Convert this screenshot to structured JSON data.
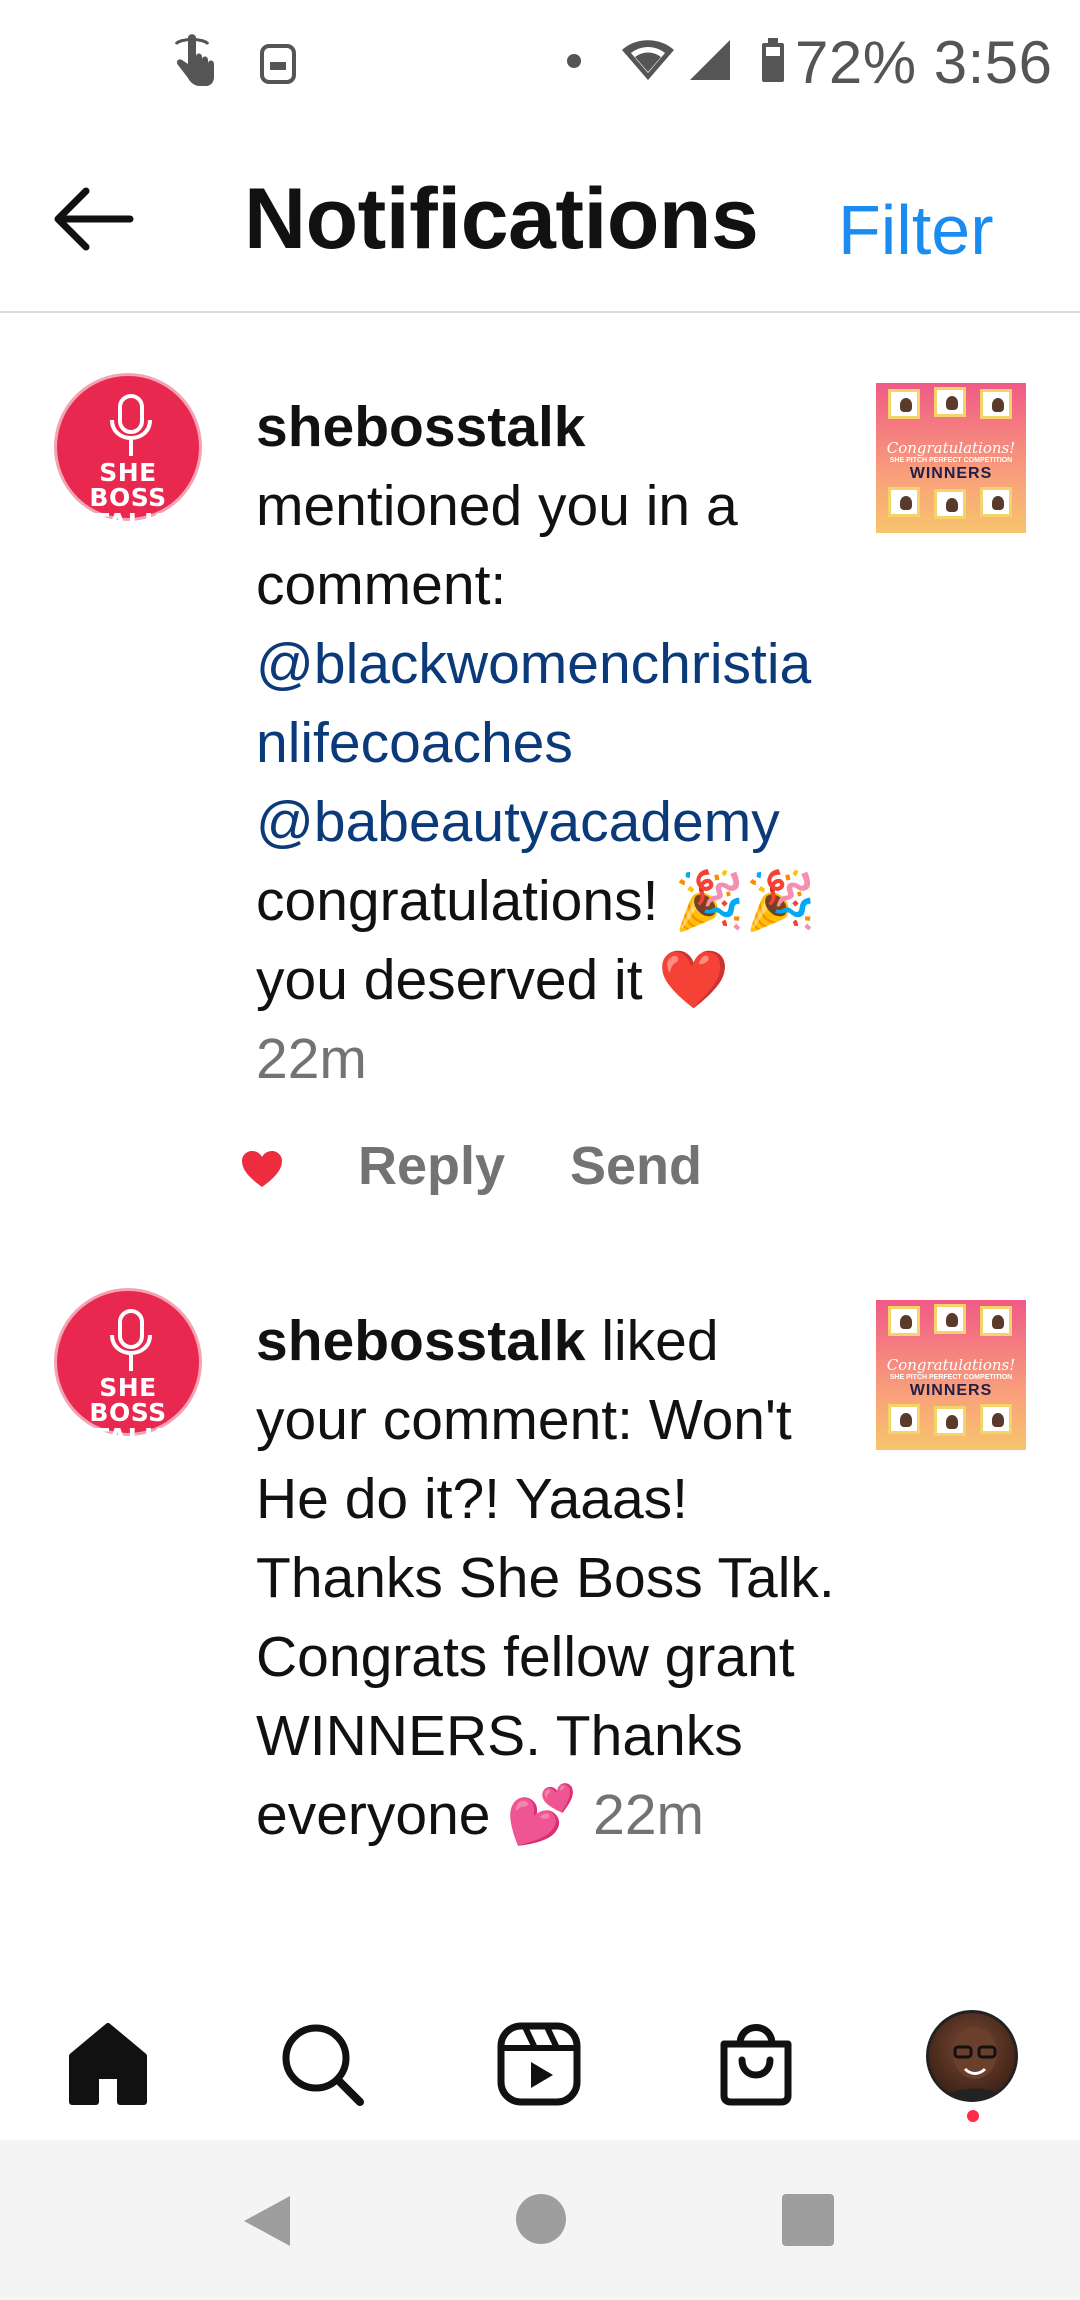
{
  "status_bar": {
    "battery": "72%",
    "time": "3:56",
    "icons": [
      "touch-gesture-icon",
      "screen-icon",
      "notification-dot-icon",
      "wifi-icon",
      "cell-signal-icon",
      "battery-icon"
    ]
  },
  "header": {
    "back_icon": "arrow-left-icon",
    "title": "Notifications",
    "filter_label": "Filter",
    "filter_color": "#1a8cf0"
  },
  "notifications": [
    {
      "avatar": {
        "top_text": "SHE BOSS",
        "bottom_text": "TALK",
        "bg_color": "#e8284f",
        "icon": "microphone-icon"
      },
      "username": "shebosstalk",
      "action": "mentioned you in a comment:",
      "mention1": "@blackwomenchristianlifecoaches",
      "mention2": "@babeautyacademy",
      "body": "congratulations! 🎉🎉 you deserved it ❤️",
      "time": "22m",
      "thumbnail": {
        "congrats": "Congratulations!",
        "subtitle": "SHE PITCH PERFECT COMPETITION",
        "winners": "WINNERS"
      },
      "actions": {
        "like_icon": "heart-filled-icon",
        "like_color": "#ed2d3f",
        "reply": "Reply",
        "send": "Send"
      }
    },
    {
      "avatar": {
        "top_text": "SHE BOSS",
        "bottom_text": "TALK",
        "bg_color": "#e8284f",
        "icon": "microphone-icon"
      },
      "username": "shebosstalk",
      "action": "liked your comment:",
      "body": "Won't He do it?! Yaaas! Thanks She Boss Talk. Congrats fellow grant WINNERS. Thanks everyone 💕",
      "time": "22m",
      "thumbnail": {
        "congrats": "Congratulations!",
        "subtitle": "SHE PITCH PERFECT COMPETITION",
        "winners": "WINNERS"
      }
    }
  ],
  "tab_bar": {
    "tabs": [
      "home-icon",
      "search-icon",
      "reels-icon",
      "shop-icon",
      "profile-avatar"
    ],
    "notification_dot_color": "#ff2b49"
  },
  "nav_bar": {
    "icons": [
      "back-triangle-icon",
      "home-circle-icon",
      "recents-square-icon"
    ]
  }
}
